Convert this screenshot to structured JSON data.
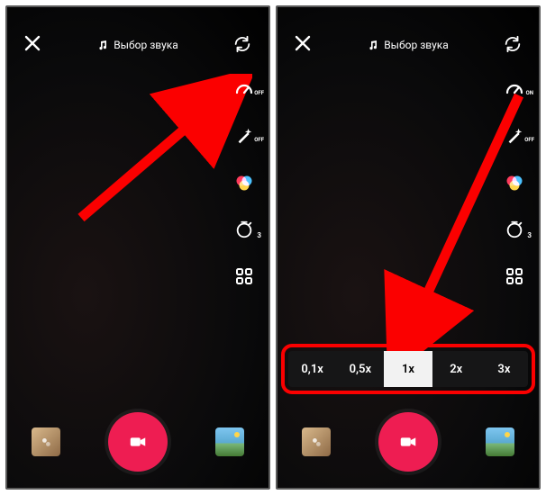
{
  "sound_label": "Выбор звука",
  "side": {
    "speed_off_sub": "OFF",
    "speed_on_sub": "ON",
    "beauty_sub": "OFF",
    "timer_sub": "3"
  },
  "speed_bar": {
    "options": [
      "0,1x",
      "0,5x",
      "1x",
      "2x",
      "3x"
    ],
    "active_index": 2
  }
}
